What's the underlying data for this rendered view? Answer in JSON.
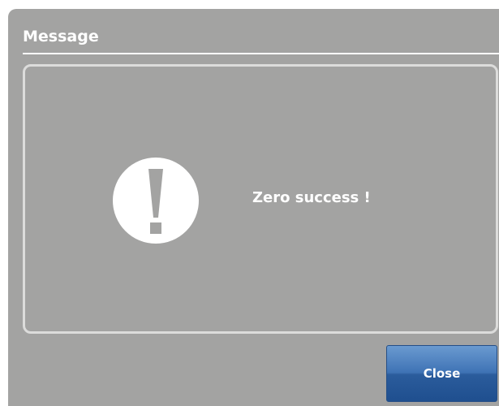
{
  "dialog": {
    "title": "Message",
    "message": "Zero success !",
    "icon": "exclamation-circle-icon",
    "close_label": "Close"
  },
  "colors": {
    "dialog_background": "#a3a3a2",
    "text": "#ffffff",
    "box_border": "#dcdcdb",
    "button_blue": "#2b5c9c"
  }
}
